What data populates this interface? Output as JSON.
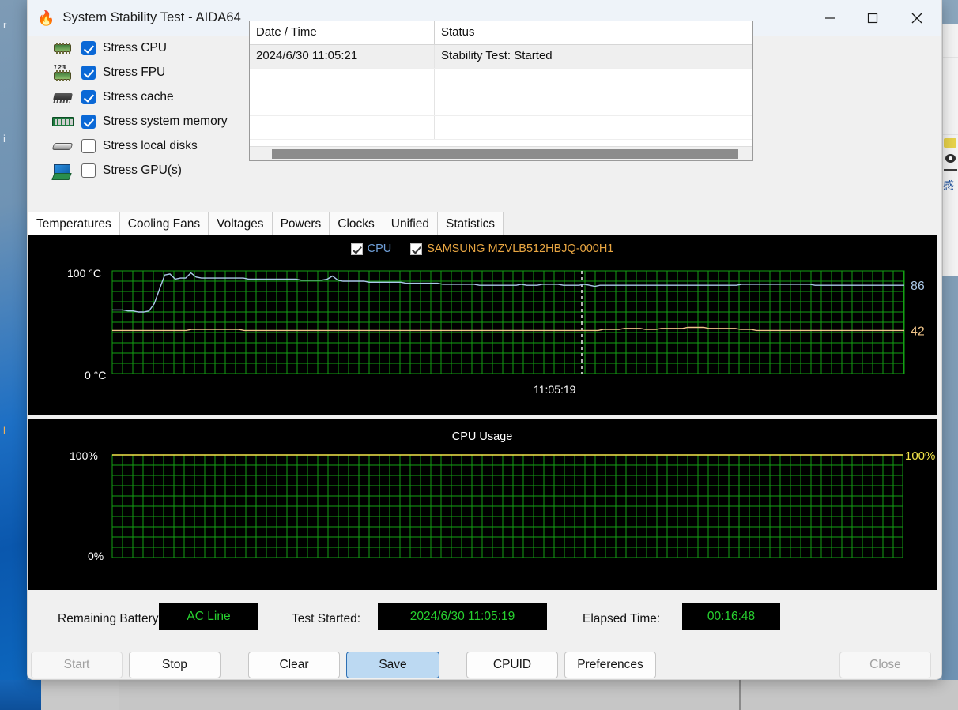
{
  "window": {
    "title": "System Stability Test - AIDA64",
    "app_icon": "flame-icon",
    "minimize": "minimize-icon",
    "maximize": "maximize-icon",
    "close": "close-icon"
  },
  "stress_options": [
    {
      "icon": "cpu-chip-icon",
      "label": "Stress CPU",
      "checked": true
    },
    {
      "icon": "fpu-chip-icon",
      "label": "Stress FPU",
      "checked": true
    },
    {
      "icon": "cache-chip-icon",
      "label": "Stress cache",
      "checked": true
    },
    {
      "icon": "memory-ram-icon",
      "label": "Stress system memory",
      "checked": true
    },
    {
      "icon": "hard-disk-icon",
      "label": "Stress local disks",
      "checked": false
    },
    {
      "icon": "gpu-card-icon",
      "label": "Stress GPU(s)",
      "checked": false
    }
  ],
  "log": {
    "columns": [
      "Date / Time",
      "Status"
    ],
    "rows": [
      {
        "datetime": "2024/6/30 11:05:21",
        "status": "Stability Test: Started",
        "selected": true
      },
      {
        "datetime": "",
        "status": "",
        "selected": false
      },
      {
        "datetime": "",
        "status": "",
        "selected": false
      },
      {
        "datetime": "",
        "status": "",
        "selected": false
      }
    ]
  },
  "tabs": [
    {
      "label": "Temperatures",
      "active": true
    },
    {
      "label": "Cooling Fans",
      "active": false
    },
    {
      "label": "Voltages",
      "active": false
    },
    {
      "label": "Powers",
      "active": false
    },
    {
      "label": "Clocks",
      "active": false
    },
    {
      "label": "Unified",
      "active": false
    },
    {
      "label": "Statistics",
      "active": false
    }
  ],
  "chart_data": [
    {
      "type": "line",
      "name": "temperatures-chart",
      "title": "",
      "ylabel_top": "100 °C",
      "ylabel_bottom": "0 °C",
      "ylim": [
        0,
        100
      ],
      "grid": true,
      "grid_color": "#13a013",
      "background": "#000000",
      "xlabel": "",
      "time_marker": "11:05:19",
      "legend_position": "top-center",
      "series": [
        {
          "name": "CPU",
          "color": "#aac8e8",
          "checked": true,
          "current_value": 86,
          "unit": "°C",
          "values": [
            62,
            62,
            62,
            61,
            61,
            60,
            60,
            61,
            68,
            82,
            96,
            97,
            92,
            93,
            93,
            98,
            94,
            93,
            93,
            93,
            93,
            93,
            93,
            93,
            93,
            93,
            92,
            92,
            92,
            92,
            92,
            92,
            92,
            92,
            92,
            92,
            91,
            91,
            91,
            91,
            91,
            92,
            95,
            91,
            90,
            90,
            90,
            90,
            90,
            89,
            89,
            89,
            89,
            89,
            89,
            89,
            88,
            88,
            88,
            88,
            88,
            88,
            88,
            87,
            87,
            87,
            87,
            87,
            87,
            87,
            86,
            86,
            86,
            86,
            86,
            86,
            86,
            86,
            87,
            86,
            86,
            86,
            87,
            87,
            87,
            87,
            86,
            86,
            86,
            86,
            87,
            86,
            85,
            86,
            86,
            86,
            86,
            86,
            86,
            86,
            86,
            86,
            86,
            86,
            86,
            86,
            86,
            86,
            86,
            86,
            86,
            86,
            86,
            86,
            86,
            86,
            86,
            86,
            86,
            86,
            87,
            87,
            87,
            87,
            87,
            87,
            87,
            87,
            87,
            87,
            87,
            87,
            87,
            87,
            86,
            86,
            86,
            86,
            86,
            86,
            86,
            86,
            86,
            86,
            86,
            86,
            86,
            86,
            86,
            86,
            86,
            86
          ]
        },
        {
          "name": "SAMSUNG MZVLB512HBJQ-000H1",
          "color": "#f0c58a",
          "checked": true,
          "current_value": 42,
          "unit": "°C",
          "values": [
            42,
            42,
            42,
            42,
            42,
            42,
            42,
            42,
            42,
            42,
            42,
            42,
            42,
            42,
            42,
            43,
            43,
            43,
            43,
            43,
            43,
            43,
            43,
            43,
            43,
            42,
            42,
            42,
            42,
            42,
            42,
            42,
            42,
            42,
            42,
            42,
            42,
            42,
            42,
            42,
            42,
            42,
            42,
            42,
            42,
            42,
            42,
            42,
            42,
            42,
            42,
            42,
            42,
            42,
            42,
            42,
            42,
            42,
            42,
            42,
            42,
            42,
            42,
            42,
            42,
            42,
            42,
            42,
            42,
            42,
            42,
            42,
            42,
            42,
            42,
            42,
            42,
            42,
            42,
            42,
            42,
            42,
            42,
            42,
            42,
            42,
            42,
            42,
            42,
            42,
            42,
            42,
            42,
            43,
            43,
            43,
            43,
            44,
            44,
            44,
            44,
            43,
            43,
            43,
            44,
            44,
            44,
            44,
            44,
            45,
            45,
            45,
            45,
            44,
            44,
            44,
            44,
            44,
            44,
            43,
            43,
            43,
            42,
            42,
            42,
            42,
            42,
            42,
            42,
            42,
            42,
            42,
            42,
            42,
            42,
            42,
            42,
            42,
            42,
            42,
            42,
            42,
            42,
            42,
            42,
            42,
            42,
            42,
            42,
            42,
            42
          ]
        }
      ]
    },
    {
      "type": "line",
      "name": "cpu-usage-chart",
      "title": "CPU Usage",
      "ylabel_top": "100%",
      "ylabel_bottom": "0%",
      "ylim": [
        0,
        100
      ],
      "grid": true,
      "grid_color": "#13a013",
      "background": "#000000",
      "current_value_label": "100%",
      "legend_position": "none",
      "series": [
        {
          "name": "CPU Usage",
          "color": "#f2e54a",
          "current_value": 100,
          "unit": "%",
          "values": [
            100,
            100,
            100,
            100,
            100,
            100,
            100,
            100,
            100,
            100,
            100,
            100,
            100,
            100,
            100,
            100,
            100,
            100,
            100,
            100,
            100,
            100,
            100,
            100,
            100,
            100,
            100,
            100,
            100,
            100,
            100,
            100,
            100,
            100,
            100,
            100,
            100,
            100,
            100,
            100,
            100,
            100,
            100,
            100,
            100,
            100,
            100,
            100,
            100,
            100,
            100,
            100,
            100,
            100,
            100,
            100,
            100,
            100,
            100,
            100,
            100,
            100,
            100,
            100,
            100,
            100,
            100,
            100,
            100,
            100,
            100,
            100,
            100,
            100,
            100,
            100,
            100,
            100,
            100,
            100
          ]
        }
      ]
    }
  ],
  "status": {
    "battery_label": "Remaining Battery:",
    "battery_value": "AC Line",
    "started_label": "Test Started:",
    "started_value": "2024/6/30 11:05:19",
    "elapsed_label": "Elapsed Time:",
    "elapsed_value": "00:16:48",
    "value_color": "#27d02f"
  },
  "buttons": [
    {
      "label": "Start",
      "state": "disabled"
    },
    {
      "label": "Stop",
      "state": "normal"
    },
    {
      "label": "Clear",
      "state": "normal"
    },
    {
      "label": "Save",
      "state": "primary"
    },
    {
      "label": "CPUID",
      "state": "normal"
    },
    {
      "label": "Preferences",
      "state": "normal"
    },
    {
      "label": "Close",
      "state": "disabled"
    }
  ]
}
